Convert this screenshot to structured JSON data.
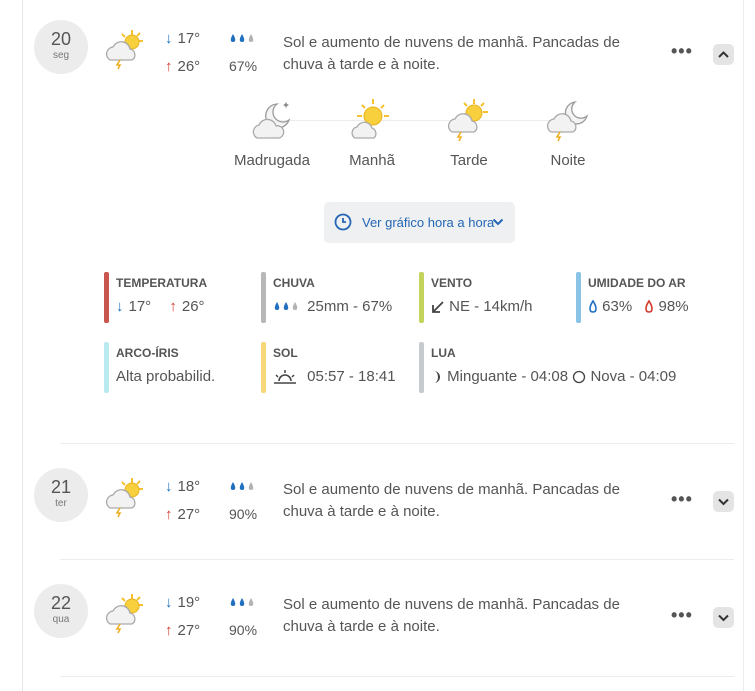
{
  "colors": {
    "temperature": "#c8554e",
    "rain": "#b7b7b7",
    "wind": "#c3d35c",
    "humidity": "#89c3e6",
    "rainbow": "#b9eaf0",
    "sun": "#f6d77a",
    "moon": "#c6cbd0",
    "down_arrow": "#1e6fbd",
    "up_arrow": "#d43b2b",
    "link": "#2466b5"
  },
  "days": [
    {
      "day_num": "20",
      "weekday": "seg",
      "icon": "partly-sunny-storm-icon",
      "min": "17°",
      "max": "26°",
      "rain_prob": "67%",
      "description": "Sol e aumento de nuvens de manhã. Pancadas de chuva à tarde e à noite.",
      "expanded": true
    },
    {
      "day_num": "21",
      "weekday": "ter",
      "icon": "partly-sunny-storm-icon",
      "min": "18°",
      "max": "27°",
      "rain_prob": "90%",
      "description": "Sol e aumento de nuvens de manhã. Pancadas de chuva à tarde e à noite.",
      "expanded": false
    },
    {
      "day_num": "22",
      "weekday": "qua",
      "icon": "partly-sunny-storm-icon",
      "min": "19°",
      "max": "27°",
      "rain_prob": "90%",
      "description": "Sol e aumento de nuvens de manhã. Pancadas de chuva à tarde e à noite.",
      "expanded": false
    }
  ],
  "periods": [
    {
      "label": "Madrugada",
      "icon": "cloudy-moon-icon"
    },
    {
      "label": "Manhã",
      "icon": "sun-cloud-icon"
    },
    {
      "label": "Tarde",
      "icon": "sun-cloud-storm-icon"
    },
    {
      "label": "Noite",
      "icon": "moon-cloud-storm-icon"
    }
  ],
  "hourly_button": "Ver gráfico hora a hora",
  "details": {
    "temperature": {
      "title": "TEMPERATURA",
      "min": "17°",
      "max": "26°"
    },
    "rain": {
      "title": "CHUVA",
      "value": "25mm - 67%"
    },
    "wind": {
      "title": "VENTO",
      "value": "NE - 14km/h"
    },
    "humidity": {
      "title": "UMIDADE DO AR",
      "min": "63%",
      "max": "98%"
    },
    "rainbow": {
      "title": "ARCO-ÍRIS",
      "value": "Alta probabilid."
    },
    "sun": {
      "title": "SOL",
      "value": "05:57 - 18:41"
    },
    "moon": {
      "title": "LUA",
      "phase1": "Minguante - 04:08",
      "phase2": "Nova - 04:09"
    }
  }
}
